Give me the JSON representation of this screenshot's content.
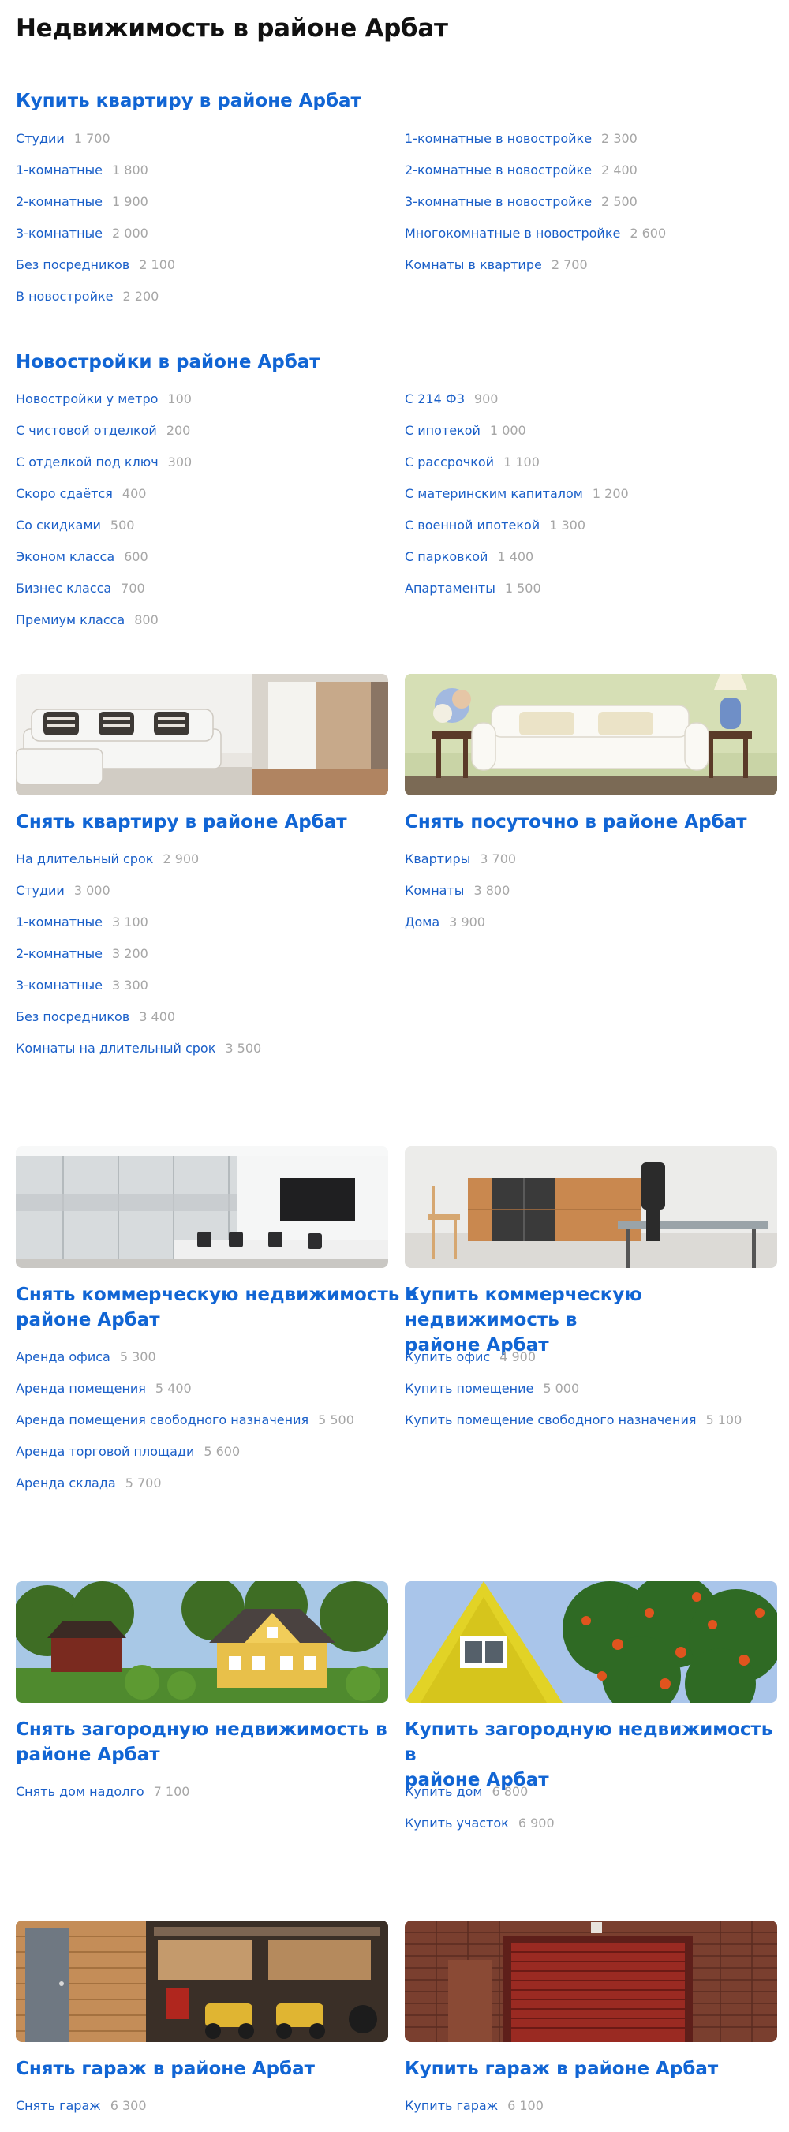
{
  "page_title": "Недвижимость в районе Арбат",
  "sections": {
    "buy_flat": {
      "title": "Купить квартиру в районе Арбат",
      "left": [
        {
          "label": "Студии",
          "count": "1 700"
        },
        {
          "label": "1-комнатные",
          "count": "1 800"
        },
        {
          "label": "2-комнатные",
          "count": "1 900"
        },
        {
          "label": "3-комнатные",
          "count": "2 000"
        },
        {
          "label": "Без посредников",
          "count": "2 100"
        },
        {
          "label": "В новостройке",
          "count": "2 200"
        }
      ],
      "right": [
        {
          "label": "1-комнатные в новостройке",
          "count": "2 300"
        },
        {
          "label": "2-комнатные в новостройке",
          "count": "2 400"
        },
        {
          "label": "3-комнатные в новостройке",
          "count": "2 500"
        },
        {
          "label": "Многокомнатные в новостройке",
          "count": "2 600"
        },
        {
          "label": "Комнаты в квартире",
          "count": "2 700"
        }
      ]
    },
    "new_buildings": {
      "title": "Новостройки в районе Арбат",
      "left": [
        {
          "label": "Новостройки у метро",
          "count": "100"
        },
        {
          "label": "С чистовой отделкой",
          "count": "200"
        },
        {
          "label": "С отделкой под ключ",
          "count": "300"
        },
        {
          "label": "Скоро сдаётся",
          "count": "400"
        },
        {
          "label": "Со скидками",
          "count": "500"
        },
        {
          "label": "Эконом класса",
          "count": "600"
        },
        {
          "label": "Бизнес класса",
          "count": "700"
        },
        {
          "label": "Премиум класса",
          "count": "800"
        }
      ],
      "right": [
        {
          "label": "С 214 ФЗ",
          "count": "900"
        },
        {
          "label": "С ипотекой",
          "count": "1 000"
        },
        {
          "label": "С рассрочкой",
          "count": "1 100"
        },
        {
          "label": "С материнским капиталом",
          "count": "1 200"
        },
        {
          "label": "С военной ипотекой",
          "count": "1 300"
        },
        {
          "label": "С парковкой",
          "count": "1 400"
        },
        {
          "label": "Апартаменты",
          "count": "1 500"
        }
      ]
    },
    "rent_flat": {
      "title": "Снять квартиру в районе Арбат",
      "items": [
        {
          "label": "На длительный срок",
          "count": "2 900"
        },
        {
          "label": "Студии",
          "count": "3 000"
        },
        {
          "label": "1-комнатные",
          "count": "3 100"
        },
        {
          "label": "2-комнатные",
          "count": "3 200"
        },
        {
          "label": "3-комнатные",
          "count": "3 300"
        },
        {
          "label": "Без посредников",
          "count": "3 400"
        },
        {
          "label": "Комнаты на длительный срок",
          "count": "3 500"
        }
      ]
    },
    "daily": {
      "title": "Снять посуточно в районе Арбат",
      "items": [
        {
          "label": "Квартиры",
          "count": "3 700"
        },
        {
          "label": "Комнаты",
          "count": "3 800"
        },
        {
          "label": "Дома",
          "count": "3 900"
        }
      ]
    },
    "rent_commercial": {
      "title_line1": "Снять коммерческую недвижимость в",
      "title_line2": "районе Арбат",
      "items": [
        {
          "label": "Аренда офиса",
          "count": "5 300"
        },
        {
          "label": "Аренда помещения",
          "count": "5 400"
        },
        {
          "label": "Аренда помещения свободного назначения",
          "count": "5 500"
        },
        {
          "label": "Аренда торговой площади",
          "count": "5 600"
        },
        {
          "label": "Аренда склада",
          "count": "5 700"
        }
      ]
    },
    "buy_commercial": {
      "title_line1": "Купить коммерческую недвижимость в",
      "title_line2": "районе Арбат",
      "items": [
        {
          "label": "Купить офис",
          "count": "4 900"
        },
        {
          "label": "Купить помещение",
          "count": "5 000"
        },
        {
          "label": "Купить помещение свободного назначения",
          "count": "5 100"
        }
      ]
    },
    "rent_country": {
      "title_line1": "Снять загородную недвижимость в",
      "title_line2": "районе Арбат",
      "items": [
        {
          "label": "Снять дом надолго",
          "count": "7 100"
        }
      ]
    },
    "buy_country": {
      "title_line1": "Купить загородную недвижимость в",
      "title_line2": "районе Арбат",
      "items": [
        {
          "label": "Купить дом",
          "count": "6 800"
        },
        {
          "label": "Купить участок",
          "count": "6 900"
        }
      ]
    },
    "rent_garage": {
      "title": "Снять гараж в районе Арбат",
      "items": [
        {
          "label": "Снять гараж",
          "count": "6 300"
        }
      ]
    },
    "buy_garage": {
      "title": "Купить гараж в районе Арбат",
      "items": [
        {
          "label": "Купить гараж",
          "count": "6 100"
        }
      ]
    }
  },
  "colors": {
    "link": "#1a5fc8",
    "title": "#1165d4",
    "count": "#a6a6a6"
  }
}
